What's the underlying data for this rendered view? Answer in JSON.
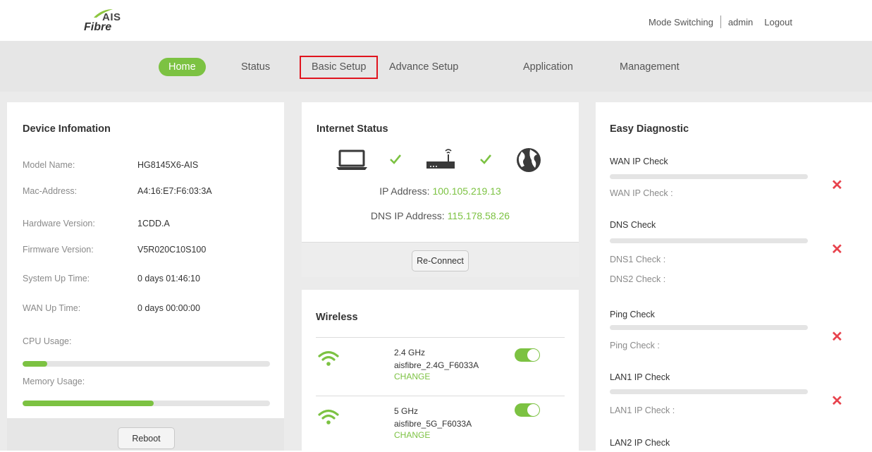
{
  "header": {
    "logo_top": "AIS",
    "logo_bottom": "Fibre",
    "mode_switching": "Mode Switching",
    "user": "admin",
    "logout": "Logout"
  },
  "nav": {
    "items": [
      "Home",
      "Status",
      "Basic Setup",
      "Advance Setup",
      "Application",
      "Management"
    ],
    "active": "Home",
    "highlighted": "Basic Setup"
  },
  "device": {
    "title": "Device Infomation",
    "rows": [
      {
        "label": "Model Name:",
        "value": "HG8145X6-AIS"
      },
      {
        "label": "Mac-Address:",
        "value": "A4:16:E7:F6:03:3A"
      },
      {
        "label": "Hardware Version:",
        "value": "1CDD.A"
      },
      {
        "label": "Firmware Version:",
        "value": "V5R020C10S100"
      },
      {
        "label": "System Up Time:",
        "value": "0 days 01:46:10"
      },
      {
        "label": "WAN Up Time:",
        "value": "0 days 00:00:00"
      }
    ],
    "cpu_label": "CPU Usage:",
    "cpu_usage_fraction": 0.1,
    "memory_label": "Memory Usage:",
    "memory_usage_fraction": 0.53,
    "reboot": "Reboot"
  },
  "internet": {
    "title": "Internet Status",
    "ip_label": "IP Address:",
    "ip_value": "100.105.219.13",
    "dns_label": "DNS IP Address:",
    "dns_value": "115.178.58.26",
    "reconnect": "Re-Connect"
  },
  "wireless": {
    "title": "Wireless",
    "bands": [
      {
        "band": "2.4 GHz",
        "ssid": "aisfibre_2.4G_F6033A",
        "change": "CHANGE",
        "enabled": true
      },
      {
        "band": "5 GHz",
        "ssid": "aisfibre_5G_F6033A",
        "change": "CHANGE",
        "enabled": true
      }
    ]
  },
  "diagnostic": {
    "title": "Easy Diagnostic",
    "checks": [
      {
        "title": "WAN IP Check",
        "subs": [
          "WAN IP Check :"
        ]
      },
      {
        "title": "DNS Check",
        "subs": [
          "DNS1 Check :",
          "DNS2 Check :"
        ]
      },
      {
        "title": "Ping Check",
        "subs": [
          "Ping Check :"
        ]
      },
      {
        "title": "LAN1 IP Check",
        "subs": [
          "LAN1 IP Check :"
        ]
      },
      {
        "title": "LAN2 IP Check",
        "subs": []
      }
    ],
    "fail_mark": "✕"
  },
  "colors": {
    "accent_green": "#7cc242",
    "error_red": "#e8434d",
    "highlight_box": "#e0141e"
  }
}
